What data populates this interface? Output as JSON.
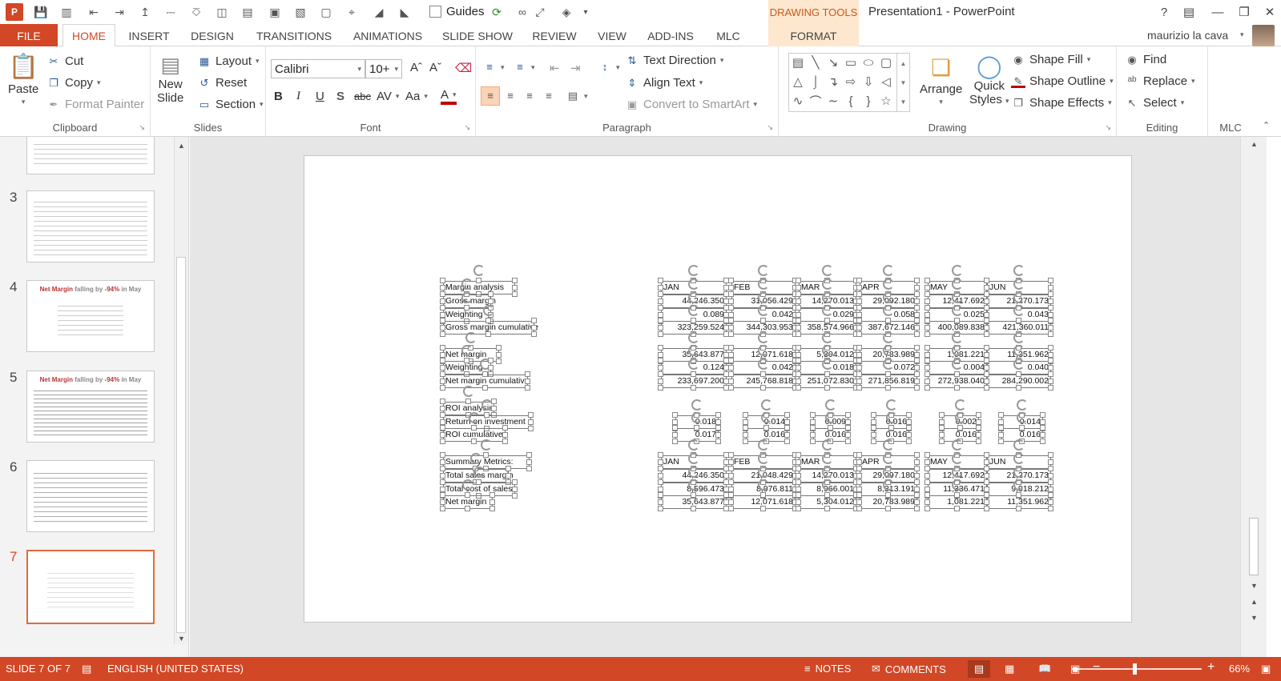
{
  "app": {
    "logo_text": "P",
    "guides_label": "Guides",
    "context_group": "DRAWING TOOLS",
    "document_title": "Presentation1 - PowerPoint",
    "help_label": "?"
  },
  "tabs": {
    "file": "FILE",
    "items": [
      "HOME",
      "INSERT",
      "DESIGN",
      "TRANSITIONS",
      "ANIMATIONS",
      "SLIDE SHOW",
      "REVIEW",
      "VIEW",
      "ADD-INS",
      "MLC",
      "FORMAT"
    ],
    "active": "HOME",
    "user": "maurizio la cava"
  },
  "ribbon": {
    "clipboard": {
      "label": "Clipboard",
      "paste": "Paste",
      "cut": "Cut",
      "copy": "Copy",
      "format_painter": "Format Painter"
    },
    "slides": {
      "label": "Slides",
      "new_slide_1": "New",
      "new_slide_2": "Slide",
      "layout": "Layout",
      "reset": "Reset",
      "section": "Section"
    },
    "font": {
      "label": "Font",
      "family": "Calibri",
      "size": "10+",
      "bold": "B",
      "italic": "I",
      "underline": "U",
      "shadow": "S",
      "strike": "abc",
      "spacing": "AV",
      "case": "Aa",
      "color": "A"
    },
    "paragraph": {
      "label": "Paragraph",
      "text_direction": "Text Direction",
      "align_text": "Align Text",
      "convert_smartart": "Convert to SmartArt"
    },
    "drawing": {
      "label": "Drawing",
      "arrange": "Arrange",
      "quick_styles_1": "Quick",
      "quick_styles_2": "Styles",
      "shape_fill": "Shape Fill",
      "shape_outline": "Shape Outline",
      "shape_effects": "Shape Effects"
    },
    "editing": {
      "label": "Editing",
      "find": "Find",
      "replace": "Replace",
      "select": "Select"
    },
    "mlc": {
      "label": "MLC"
    }
  },
  "thumbnails": {
    "numbers": [
      "3",
      "4",
      "5",
      "6",
      "7"
    ],
    "title_red": "Net Margin",
    "title_rest": " falling by ",
    "title_pct": "-94%",
    "title_end": " in May"
  },
  "slide": {
    "row_labels": [
      "Margin analysis",
      "Gross margin",
      "Weighting",
      "Gross margin cumulative",
      "Net margin",
      "Weighting",
      "Net margin cumulative",
      "ROI analysis",
      "Return on investment",
      "ROI cumulative",
      "Summary Metrics:",
      "Total sales margin",
      "Total cost of sales",
      "Net margin"
    ],
    "header1": [
      "JAN",
      "FEB",
      "MAR",
      "APR",
      "MAY",
      "JUN"
    ],
    "gross_margin": [
      "44,246.350",
      "31,056.429",
      "14,270.013",
      "29,092.180",
      "12,417.692",
      "21,270.173"
    ],
    "gm_weighting": [
      "0.089",
      "0.042",
      "0.029",
      "0.058",
      "0.025",
      "0.043"
    ],
    "gm_cumulative": [
      "323,259.524",
      "344,303.953",
      "358,574.966",
      "387,672.146",
      "400,089.838",
      "421,360.011"
    ],
    "net_margin": [
      "35,643.877",
      "12,071.618",
      "5,304.012",
      "20,783.989",
      "1,081.221",
      "11,351.962"
    ],
    "nm_weighting": [
      "0.124",
      "0.042",
      "0.018",
      "0.072",
      "0.004",
      "0.040"
    ],
    "nm_cumulative": [
      "233,697.200",
      "245,768.818",
      "251,072.830",
      "271,856.819",
      "272,938.040",
      "284,290.002"
    ],
    "roi": [
      "0.018",
      "0.014",
      "0.009",
      "0.016",
      "0.002",
      "0.014"
    ],
    "roi_cumulative": [
      "0.017",
      "0.016",
      "0.016",
      "0.016",
      "0.016",
      "0.016"
    ],
    "header2": [
      "JAN",
      "FEB",
      "MAR",
      "APR",
      "MAY",
      "JUN"
    ],
    "total_sales_margin": [
      "44,246.350",
      "21,048.429",
      "14,270.013",
      "29,097.180",
      "12,417.692",
      "21,270.173"
    ],
    "total_cost_of_sales": [
      "8,596.473",
      "8,976.811",
      "8,966.001",
      "8,313.191",
      "11,336.471",
      "9,918.212"
    ],
    "summary_net_margin": [
      "35,643.877",
      "12,071.618",
      "5,304.012",
      "20,783.989",
      "1,081.221",
      "11,351.962"
    ]
  },
  "status": {
    "slide": "SLIDE 7 OF 7",
    "language": "ENGLISH (UNITED STATES)",
    "notes": "NOTES",
    "comments": "COMMENTS",
    "zoom": "66%",
    "zoom_level_percent": 66
  },
  "colors": {
    "accent": "#d24726",
    "context_tab": "#fde7ce",
    "selection_outline": "#e16a3d"
  }
}
